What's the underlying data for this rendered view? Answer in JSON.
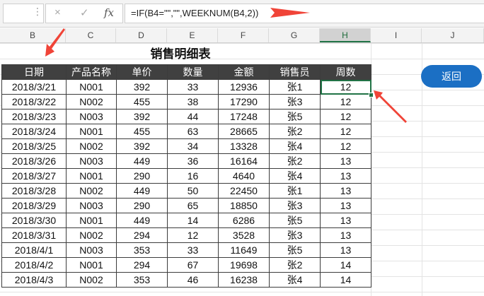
{
  "formula_bar": {
    "cancel_icon": "×",
    "confirm_icon": "✓",
    "fx_label": "fx",
    "formula": "=IF(B4=\"\",\"\",WEEKNUM(B4,2))"
  },
  "column_headers": [
    "B",
    "C",
    "D",
    "E",
    "F",
    "G",
    "H",
    "I",
    "J"
  ],
  "selected_column": "H",
  "sheet": {
    "title": "销售明细表",
    "headers": [
      "日期",
      "产品名称",
      "单价",
      "数量",
      "金额",
      "销售员",
      "周数"
    ],
    "rows": [
      [
        "2018/3/21",
        "N001",
        "392",
        "33",
        "12936",
        "张1",
        "12"
      ],
      [
        "2018/3/22",
        "N002",
        "455",
        "38",
        "17290",
        "张3",
        "12"
      ],
      [
        "2018/3/23",
        "N003",
        "392",
        "44",
        "17248",
        "张5",
        "12"
      ],
      [
        "2018/3/24",
        "N001",
        "455",
        "63",
        "28665",
        "张2",
        "12"
      ],
      [
        "2018/3/25",
        "N002",
        "392",
        "34",
        "13328",
        "张4",
        "12"
      ],
      [
        "2018/3/26",
        "N003",
        "449",
        "36",
        "16164",
        "张2",
        "13"
      ],
      [
        "2018/3/27",
        "N001",
        "290",
        "16",
        "4640",
        "张4",
        "13"
      ],
      [
        "2018/3/28",
        "N002",
        "449",
        "50",
        "22450",
        "张1",
        "13"
      ],
      [
        "2018/3/29",
        "N003",
        "290",
        "65",
        "18850",
        "张3",
        "13"
      ],
      [
        "2018/3/30",
        "N001",
        "449",
        "14",
        "6286",
        "张5",
        "13"
      ],
      [
        "2018/3/31",
        "N002",
        "294",
        "12",
        "3528",
        "张3",
        "13"
      ],
      [
        "2018/4/1",
        "N003",
        "353",
        "33",
        "11649",
        "张5",
        "13"
      ],
      [
        "2018/4/2",
        "N001",
        "294",
        "67",
        "19698",
        "张2",
        "14"
      ],
      [
        "2018/4/3",
        "N002",
        "353",
        "46",
        "16238",
        "张4",
        "14"
      ]
    ]
  },
  "return_button": "返回",
  "colors": {
    "header_bg": "#404040",
    "selection": "#217346",
    "button": "#1b6fc4",
    "arrow": "#f04438"
  }
}
